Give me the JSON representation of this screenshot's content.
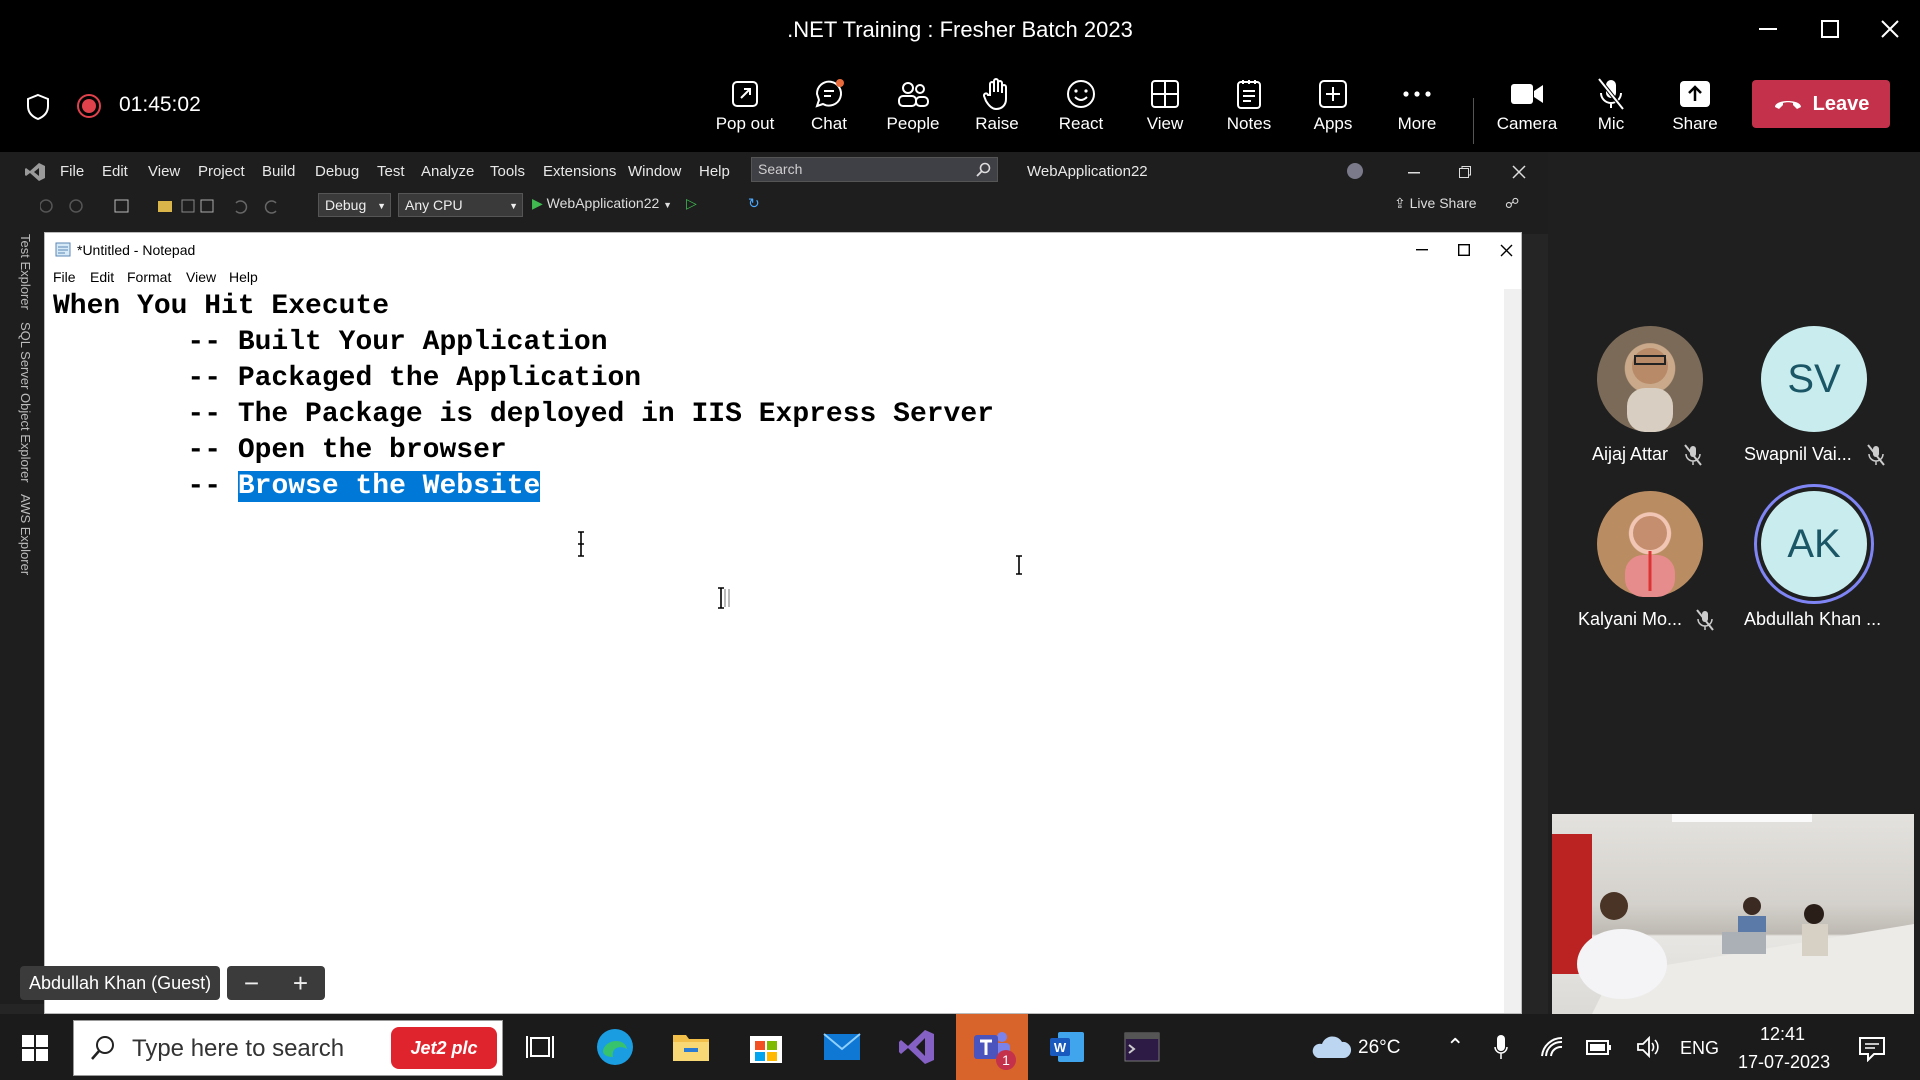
{
  "window": {
    "title": ".NET Training : Fresher Batch 2023"
  },
  "meeting": {
    "timer": "01:45:02",
    "buttons": [
      {
        "label": "Pop out",
        "icon": "popout-icon"
      },
      {
        "label": "Chat",
        "icon": "chat-icon"
      },
      {
        "label": "People",
        "icon": "people-icon"
      },
      {
        "label": "Raise",
        "icon": "raise-hand-icon"
      },
      {
        "label": "React",
        "icon": "smile-icon"
      },
      {
        "label": "View",
        "icon": "grid-icon"
      },
      {
        "label": "Notes",
        "icon": "notes-icon"
      },
      {
        "label": "Apps",
        "icon": "plus-box-icon"
      },
      {
        "label": "More",
        "icon": "ellipsis-icon"
      },
      {
        "label": "Camera",
        "icon": "camera-icon"
      },
      {
        "label": "Mic",
        "icon": "mic-off-icon"
      },
      {
        "label": "Share",
        "icon": "share-icon"
      }
    ],
    "leave_label": "Leave",
    "accent": "#c4314b"
  },
  "vs": {
    "menu": [
      "File",
      "Edit",
      "View",
      "Project",
      "Build",
      "Debug",
      "Test",
      "Analyze",
      "Tools",
      "Extensions",
      "Window",
      "Help"
    ],
    "search_placeholder": "Search",
    "project": "WebApplication22",
    "config": "Debug",
    "platform": "Any CPU",
    "run_target": "WebApplication22",
    "live_share": "Live Share",
    "side_tabs": [
      "Test Explorer",
      "SQL Server Object Explorer",
      "AWS Explorer"
    ]
  },
  "notepad": {
    "title": "*Untitled - Notepad",
    "menu": [
      "File",
      "Edit",
      "Format",
      "View",
      "Help"
    ],
    "lines": [
      "When You Hit Execute",
      "        -- Built Your Application",
      "        -- Packaged the Application",
      "        -- The Package is deployed in IIS Express Server",
      "        -- Open the browser"
    ],
    "last_prefix": "        -- ",
    "selected_text": "Browse the Website"
  },
  "participants": [
    {
      "name": "Aijaj Attar",
      "initials": "",
      "muted": true
    },
    {
      "name": "Swapnil Vai...",
      "initials": "SV",
      "muted": true
    },
    {
      "name": "Kalyani Mo...",
      "initials": "",
      "muted": true
    },
    {
      "name": "Abdullah Khan ...",
      "initials": "AK",
      "muted": false
    }
  ],
  "guest_label": "Abdullah Khan (Guest)",
  "taskbar": {
    "search_placeholder": "Type here to search",
    "promo": "Jet2 plc",
    "weather": "26°C",
    "language": "ENG",
    "time": "12:41",
    "date": "17-07-2023",
    "teams_badge": "1"
  }
}
